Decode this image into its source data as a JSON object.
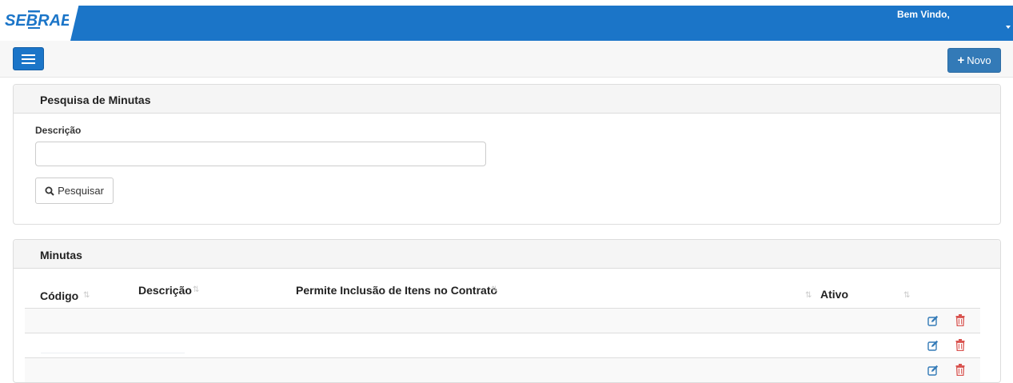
{
  "header": {
    "logo_text": "SEBRAE",
    "welcome": "Bem Vindo,",
    "brand_color": "#1b75c8"
  },
  "toolbar": {
    "menu_icon": "hamburger-icon",
    "novo_label": "Novo",
    "novo_icon": "plus-icon"
  },
  "search_panel": {
    "title": "Pesquisa de Minutas",
    "description_label": "Descrição",
    "description_value": "",
    "search_label": "Pesquisar",
    "search_icon": "search-icon"
  },
  "minutas_panel": {
    "title": "Minutas",
    "columns": [
      "Código",
      "Descrição",
      "Permite Inclusão de Itens no Contrato",
      "Ativo"
    ],
    "rows": [
      {
        "codigo": "",
        "descricao": "",
        "permite": "",
        "ativo": ""
      },
      {
        "codigo": "",
        "descricao": "",
        "permite": "",
        "ativo": ""
      },
      {
        "codigo": "",
        "descricao": "",
        "permite": "",
        "ativo": ""
      }
    ],
    "edit_icon": "edit-icon",
    "delete_icon": "trash-icon",
    "edit_color": "#337ab7",
    "delete_color": "#d9534f"
  }
}
